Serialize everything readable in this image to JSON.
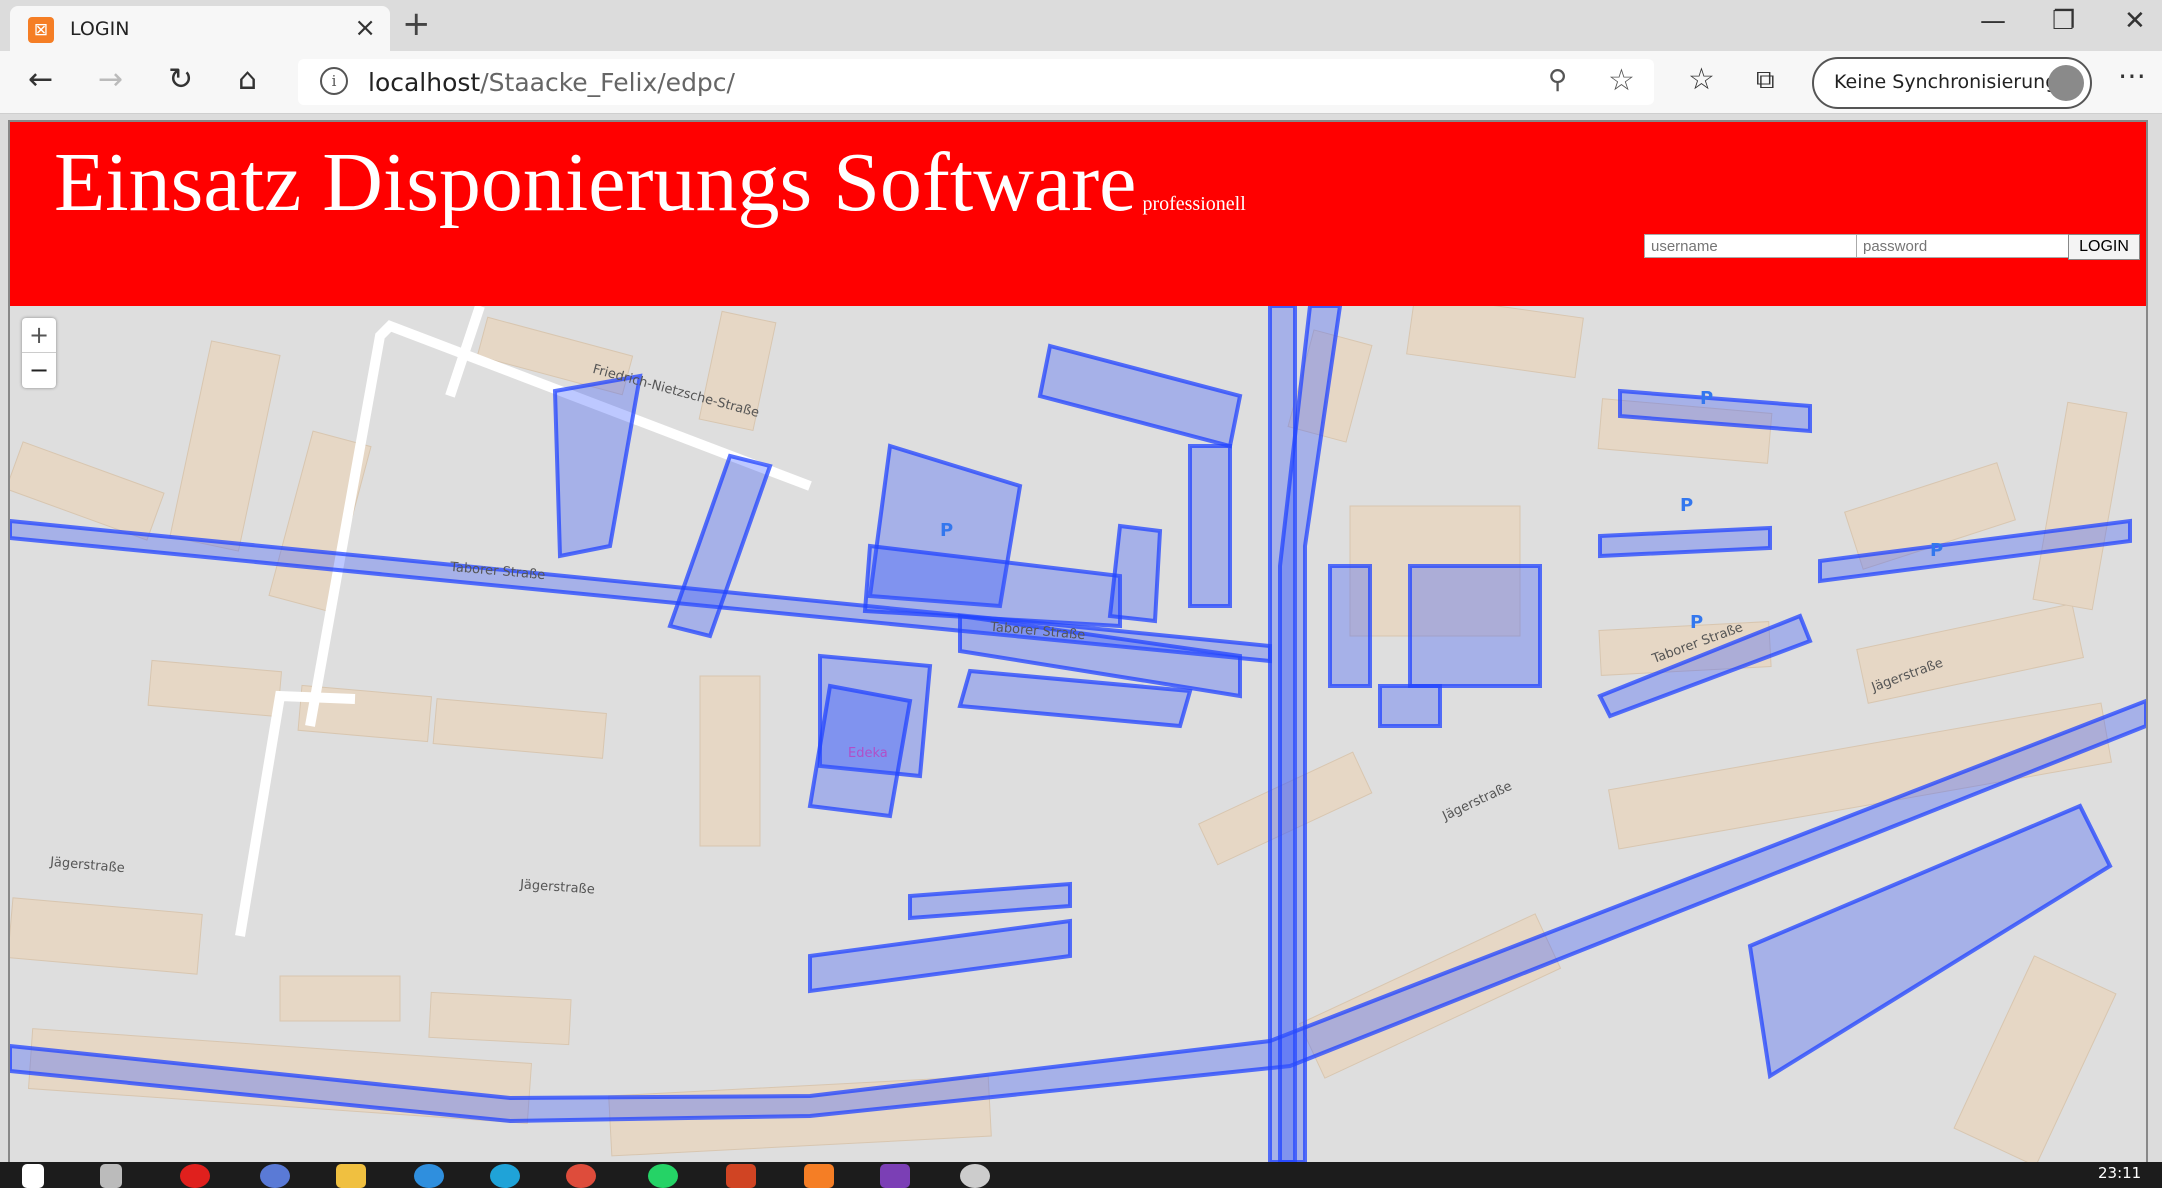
{
  "browser": {
    "tab_title": "LOGIN",
    "url_host": "localhost",
    "url_path": "/Staacke_Felix/edpc/",
    "sync_label": "Keine Synchronisierung"
  },
  "header": {
    "title": "Einsatz Disponierungs Software",
    "subtitle": "professionell",
    "username_placeholder": "username",
    "password_placeholder": "password",
    "login_button": "LOGIN"
  },
  "map": {
    "zoom_in": "+",
    "zoom_out": "−",
    "street_labels": [
      "Friedrich-Nietzsche-Straße",
      "Taborer Straße",
      "Taborer Straße",
      "Taborer Straße",
      "Jägerstraße",
      "Jägerstraße",
      "Jägerstraße",
      "Jägerstraße",
      "Edeka"
    ]
  },
  "taskbar": {
    "time": "23:11"
  },
  "colors": {
    "header_bg": "#ff0000",
    "overlay": "#3355ff"
  }
}
